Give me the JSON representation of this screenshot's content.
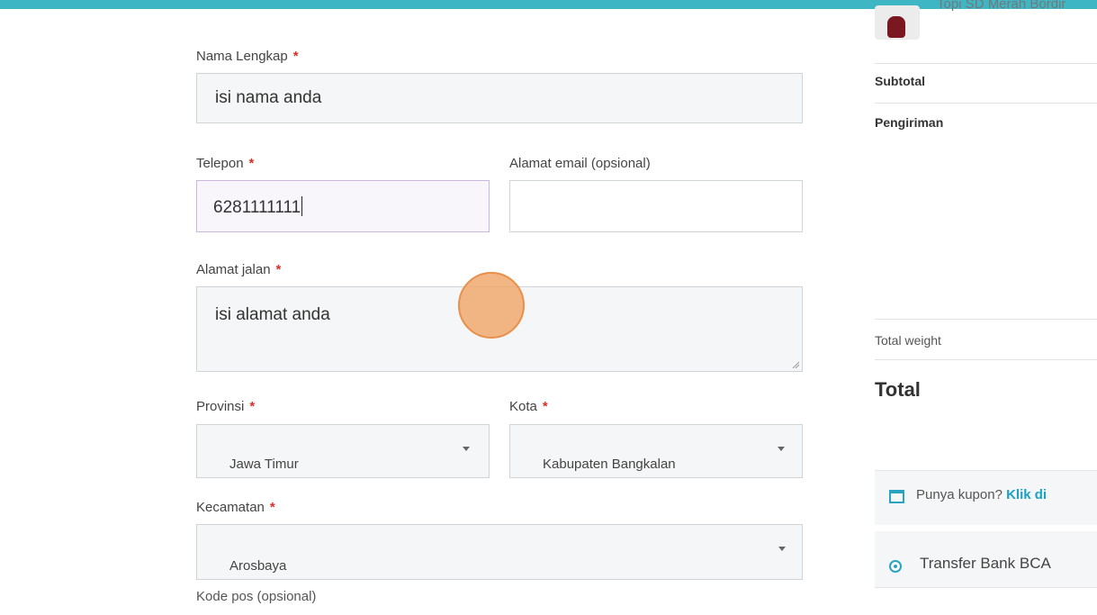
{
  "form": {
    "required_mark": "*",
    "full_name": {
      "label": "Nama Lengkap",
      "value": "isi nama anda"
    },
    "phone": {
      "label": "Telepon",
      "value": "6281111111"
    },
    "email": {
      "label": "Alamat email (opsional)",
      "value": ""
    },
    "street": {
      "label": "Alamat jalan",
      "value": "isi alamat anda"
    },
    "province": {
      "label": "Provinsi",
      "selected": "Jawa Timur"
    },
    "city": {
      "label": "Kota",
      "selected": "Kabupaten Bangkalan"
    },
    "district": {
      "label": "Kecamatan",
      "selected": "Arosbaya"
    },
    "next_label_cut": "Kode pos (opsional)"
  },
  "order_summary": {
    "product_name": "Topi SD Merah Bordir",
    "subtotal_label": "Subtotal",
    "shipping_label": "Pengiriman",
    "total_weight_label": "Total weight",
    "total_label": "Total",
    "coupon_text": "Punya kupon?",
    "coupon_link": "Klik di",
    "payment_method": "Transfer Bank BCA"
  },
  "colors": {
    "accent": "#3fb6c4",
    "required": "#d9302a",
    "link": "#1aa1c5",
    "touch": "#f0a86e"
  },
  "icons": {
    "coupon": "calendar-icon",
    "payment": "radio-icon",
    "select": "chevron-down-icon"
  }
}
